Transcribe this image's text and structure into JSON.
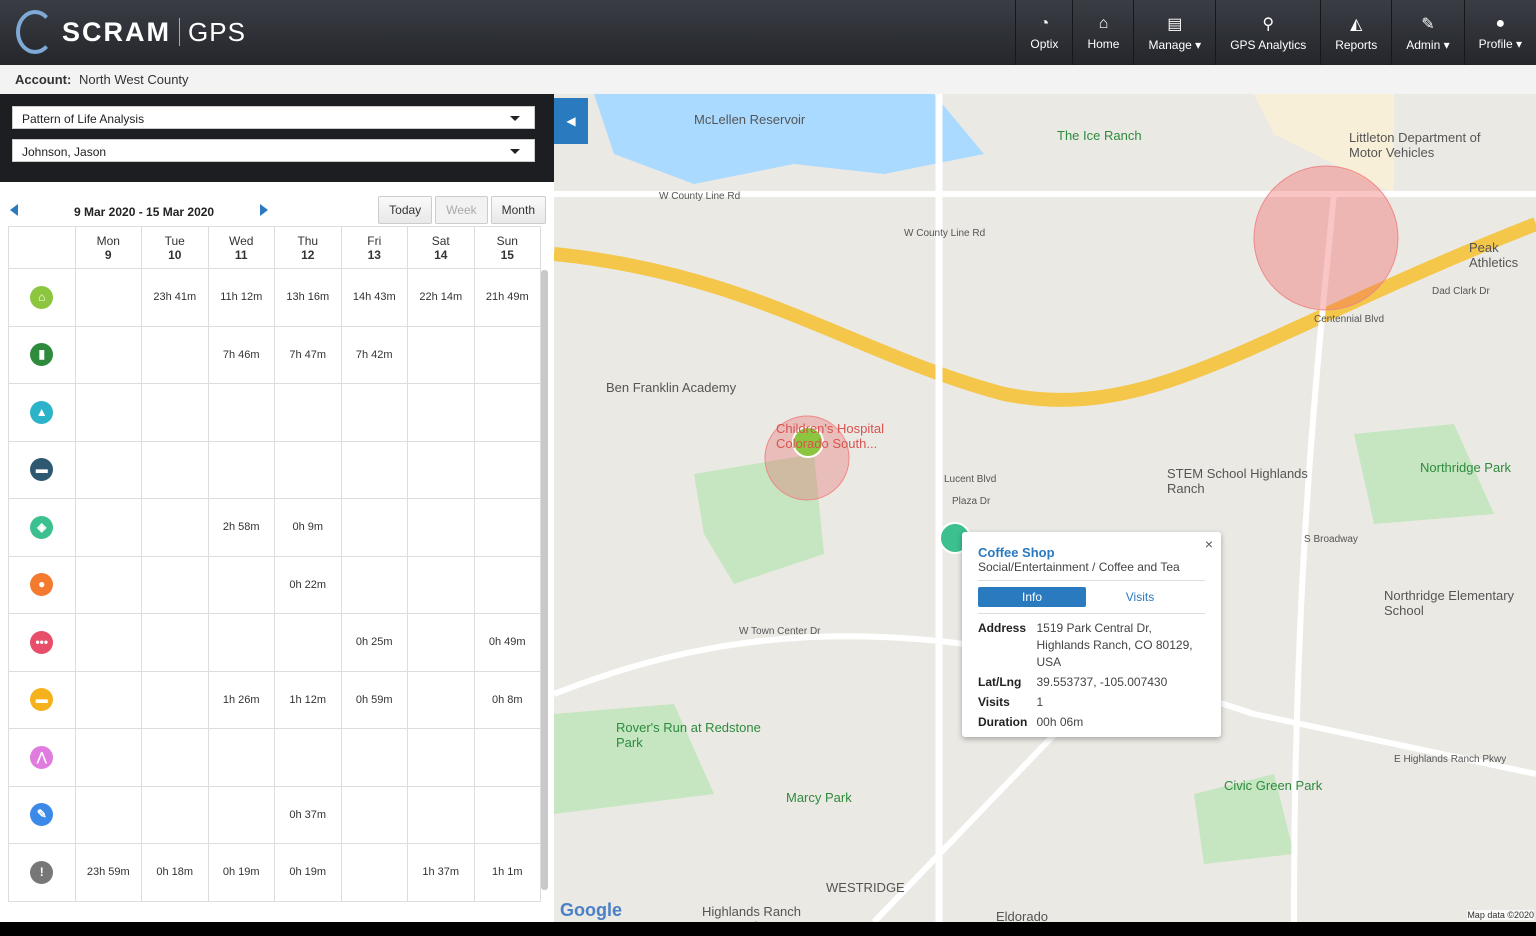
{
  "header": {
    "brand": "SCRAM",
    "product": "GPS",
    "nav": [
      {
        "label": "Optix",
        "icon": "dashboard-icon"
      },
      {
        "label": "Home",
        "icon": "home-icon"
      },
      {
        "label": "Manage ▾",
        "icon": "list-icon"
      },
      {
        "label": "GPS Analytics",
        "icon": "person-pin-icon"
      },
      {
        "label": "Reports",
        "icon": "area-chart-icon"
      },
      {
        "label": "Admin ▾",
        "icon": "wrench-icon"
      },
      {
        "label": "Profile ▾",
        "icon": "user-icon"
      }
    ]
  },
  "account": {
    "label": "Account:",
    "value": "North West County"
  },
  "filters": {
    "analysis": "Pattern of Life Analysis",
    "person": "Johnson, Jason"
  },
  "calendar": {
    "range": "9 Mar 2020 - 15 Mar 2020",
    "buttons": {
      "today": "Today",
      "week": "Week",
      "month": "Month"
    },
    "days": [
      {
        "d": "Mon",
        "n": "9"
      },
      {
        "d": "Tue",
        "n": "10"
      },
      {
        "d": "Wed",
        "n": "11"
      },
      {
        "d": "Thu",
        "n": "12"
      },
      {
        "d": "Fri",
        "n": "13"
      },
      {
        "d": "Sat",
        "n": "14"
      },
      {
        "d": "Sun",
        "n": "15"
      }
    ],
    "rows": [
      {
        "icon": "home-icon",
        "color": "#8cc63f",
        "cells": [
          "",
          "23h 41m",
          "11h 12m",
          "13h 16m",
          "14h 43m",
          "22h 14m",
          "21h 49m"
        ]
      },
      {
        "icon": "building-icon",
        "color": "#2e8b3e",
        "cells": [
          "",
          "",
          "7h 46m",
          "7h 47m",
          "7h 42m",
          "",
          ""
        ]
      },
      {
        "icon": "graduation-cap-icon",
        "color": "#2bb3c9",
        "cells": [
          "",
          "",
          "",
          "",
          "",
          "",
          ""
        ]
      },
      {
        "icon": "briefcase-icon",
        "color": "#2d5870",
        "cells": [
          "",
          "",
          "",
          "",
          "",
          "",
          ""
        ]
      },
      {
        "icon": "ticket-icon",
        "color": "#3cc08f",
        "cells": [
          "",
          "",
          "2h 58m",
          "0h 9m",
          "",
          "",
          ""
        ]
      },
      {
        "icon": "food-icon",
        "color": "#f47a30",
        "cells": [
          "",
          "",
          "",
          "0h 22m",
          "",
          "",
          ""
        ]
      },
      {
        "icon": "more-icon",
        "color": "#e84d6a",
        "cells": [
          "",
          "",
          "",
          "",
          "0h 25m",
          "",
          "0h 49m"
        ]
      },
      {
        "icon": "car-icon",
        "color": "#f5b21c",
        "cells": [
          "",
          "",
          "1h 26m",
          "1h 12m",
          "0h 59m",
          "",
          "0h 8m"
        ]
      },
      {
        "icon": "network-icon",
        "color": "#e07be0",
        "cells": [
          "",
          "",
          "",
          "",
          "",
          "",
          ""
        ]
      },
      {
        "icon": "wrench-icon",
        "color": "#3b8ae8",
        "cells": [
          "",
          "",
          "",
          "0h 37m",
          "",
          "",
          ""
        ]
      },
      {
        "icon": "alert-icon",
        "color": "#777777",
        "cells": [
          "23h 59m",
          "0h 18m",
          "0h 19m",
          "0h 19m",
          "",
          "1h 37m",
          "1h 1m"
        ]
      }
    ]
  },
  "map": {
    "labels": [
      "McLellen Reservoir",
      "The Ice Ranch",
      "Littleton Department of Motor Vehicles",
      "W County Line Rd",
      "W County Line Rd",
      "Peak Athletics",
      "Ben Franklin Academy",
      "Children's Hospital Colorado South...",
      "STEM School Highlands Ranch",
      "Northridge Park",
      "Plaza Dr",
      "Northridge Elementary School",
      "W Town Center Dr",
      "Rover's Run at Redstone Park",
      "Marcy Park",
      "Civic Green Park",
      "WESTRIDGE",
      "Highlands Ranch Community",
      "Eldorado",
      "E Highlands Ranch Pkwy",
      "Lucent Blvd",
      "S Broadway",
      "Centennial Blvd",
      "Dad Clark Dr"
    ],
    "google": "Google",
    "attribution": "Map data ©2020"
  },
  "popup": {
    "title": "Coffee Shop",
    "category": "Social/Entertainment / Coffee and Tea",
    "tabs": [
      "Info",
      "Visits"
    ],
    "fields": [
      {
        "k": "Address",
        "v": "1519 Park Central Dr, Highlands Ranch, CO 80129, USA"
      },
      {
        "k": "Lat/Lng",
        "v": "39.553737, -105.007430"
      },
      {
        "k": "Visits",
        "v": "1"
      },
      {
        "k": "Duration",
        "v": "00h 06m"
      }
    ]
  }
}
